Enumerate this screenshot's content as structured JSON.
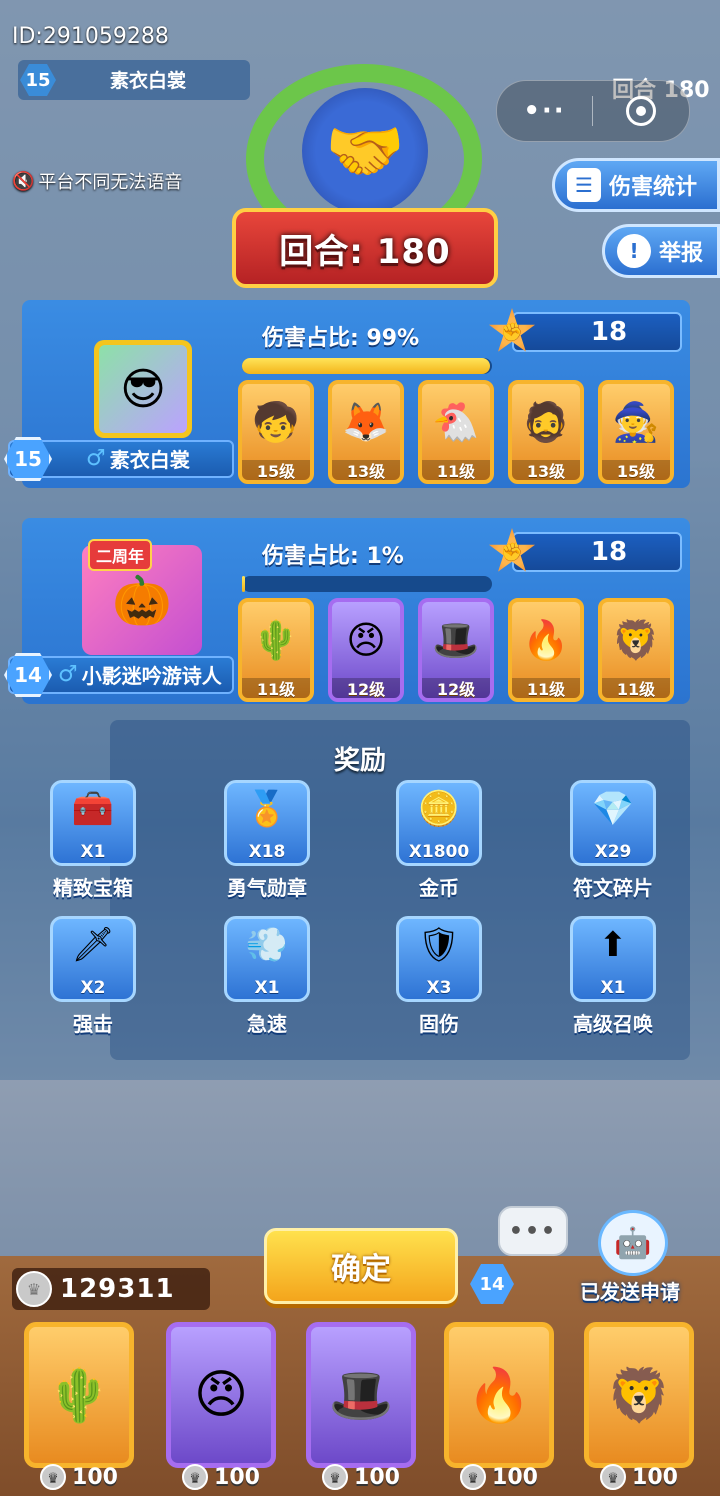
{
  "top": {
    "player_id": "ID:291059288",
    "level": "15",
    "player_name": "素衣白裳",
    "voice_notice": "平台不同无法语音",
    "round_short": "回合 180"
  },
  "capsule": {
    "more_icon": "more-dots-icon",
    "close_icon": "target-close-icon"
  },
  "side_buttons": {
    "damage_stats": "伤害统计",
    "report": "举报"
  },
  "emblem": {
    "round_label": "回合: 180",
    "icon": "handshake-icon"
  },
  "players": [
    {
      "level": "15",
      "gender_icon": "♂",
      "name": "素衣白裳",
      "damage_ratio_label": "伤害占比: 99%",
      "damage_ratio": 0.99,
      "medals": "18",
      "heroes": [
        {
          "face": "🧒",
          "level": "15级",
          "rarity": "gold"
        },
        {
          "face": "🦊",
          "level": "13级",
          "rarity": "gold"
        },
        {
          "face": "🐔",
          "level": "11级",
          "rarity": "gold"
        },
        {
          "face": "🧔",
          "level": "13级",
          "rarity": "gold"
        },
        {
          "face": "🧙",
          "level": "15级",
          "rarity": "gold"
        }
      ]
    },
    {
      "level": "14",
      "gender_icon": "♂",
      "name": "小影迷吟游诗人",
      "avatar_tag": "二周年",
      "damage_ratio_label": "伤害占比: 1%",
      "damage_ratio": 0.01,
      "medals": "18",
      "heroes": [
        {
          "face": "🌵",
          "level": "11级",
          "rarity": "gold"
        },
        {
          "face": "😠",
          "level": "12级",
          "rarity": "purple"
        },
        {
          "face": "🎩",
          "level": "12级",
          "rarity": "purple"
        },
        {
          "face": "🔥",
          "level": "11级",
          "rarity": "gold"
        },
        {
          "face": "🦁",
          "level": "11级",
          "rarity": "gold"
        }
      ]
    }
  ],
  "rewards": {
    "title": "奖励",
    "items": [
      {
        "icon": "🧰",
        "count": "X1",
        "label": "精致宝箱"
      },
      {
        "icon": "🏅",
        "count": "X18",
        "label": "勇气勋章"
      },
      {
        "icon": "🪙",
        "count": "X1800",
        "label": "金币"
      },
      {
        "icon": "💎",
        "count": "X29",
        "label": "符文碎片"
      },
      {
        "icon": "🗡",
        "count": "X2",
        "label": "强击"
      },
      {
        "icon": "💨",
        "count": "X1",
        "label": "急速"
      },
      {
        "icon": "🛡",
        "count": "X3",
        "label": "固伤"
      },
      {
        "icon": "⬆",
        "count": "X1",
        "label": "高级召唤"
      }
    ]
  },
  "bottom": {
    "coins": "129311",
    "confirm": "确定",
    "chat_icon": "chat-bubble-icon",
    "opponent_level": "14",
    "request_sent": "已发送申请",
    "cards": [
      {
        "face": "🌵",
        "cost": "100",
        "rarity": "gold"
      },
      {
        "face": "😠",
        "cost": "100",
        "rarity": "purple"
      },
      {
        "face": "🎩",
        "cost": "100",
        "rarity": "purple"
      },
      {
        "face": "🔥",
        "cost": "100",
        "rarity": "gold"
      },
      {
        "face": "🦁",
        "cost": "100",
        "rarity": "gold"
      }
    ]
  }
}
